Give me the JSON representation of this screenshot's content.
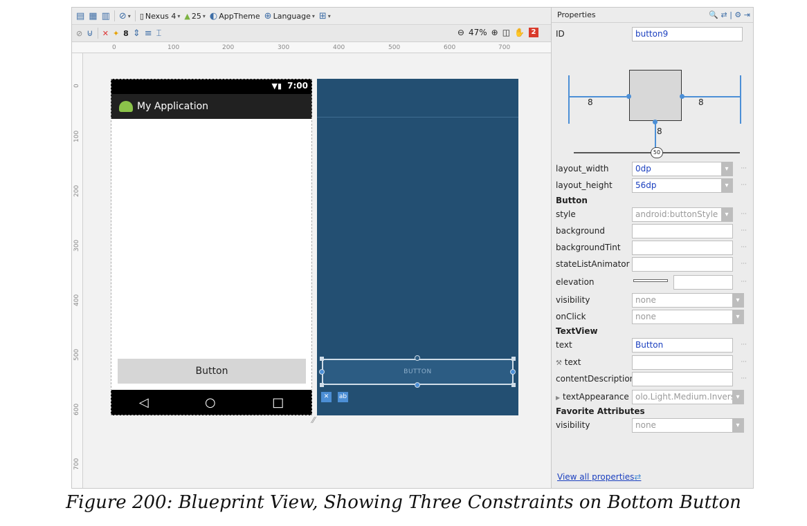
{
  "toolbar1": {
    "device": "Nexus 4",
    "api": "25",
    "theme": "AppTheme",
    "language": "Language"
  },
  "toolbar2": {
    "default_margin": "8",
    "zoom": "47%",
    "error_count": "2"
  },
  "rulers": {
    "horizontal": [
      "0",
      "100",
      "200",
      "300",
      "400",
      "500",
      "600",
      "700"
    ],
    "vertical": [
      "0",
      "100",
      "200",
      "300",
      "400",
      "500",
      "600",
      "700"
    ]
  },
  "phone": {
    "time": "7:00",
    "app_title": "My Application",
    "button_label": "Button"
  },
  "blueprint": {
    "button_label": "BUTTON"
  },
  "properties": {
    "title": "Properties",
    "id_label": "ID",
    "id_value": "button9",
    "constraint_left": "8",
    "constraint_right": "8",
    "constraint_bottom": "8",
    "bias": "50",
    "layout_width_label": "layout_width",
    "layout_width_value": "0dp",
    "layout_height_label": "layout_height",
    "layout_height_value": "56dp",
    "section_button": "Button",
    "style_label": "style",
    "style_value": "android:buttonStyle",
    "background_label": "background",
    "background_tint_label": "backgroundTint",
    "state_list_animator_label": "stateListAnimator",
    "elevation_label": "elevation",
    "visibility_label": "visibility",
    "visibility_value": "none",
    "onclick_label": "onClick",
    "onclick_value": "none",
    "section_textview": "TextView",
    "text_label": "text",
    "text_value": "Button",
    "tools_text_label": "text",
    "content_description_label": "contentDescription",
    "text_appearance_label": "textAppearance",
    "text_appearance_value": "olo.Light.Medium.Inverse",
    "section_favorite": "Favorite Attributes",
    "fav_visibility_label": "visibility",
    "fav_visibility_value": "none",
    "view_all": "View all properties"
  },
  "caption": "Figure 200: Blueprint View, Showing Three Constraints on Bottom Button",
  "colors": {
    "blueprint_bg": "#234f72",
    "accent_blue": "#4c8fd6",
    "link_blue": "#1a3fbf",
    "error_red": "#d93a2b"
  }
}
